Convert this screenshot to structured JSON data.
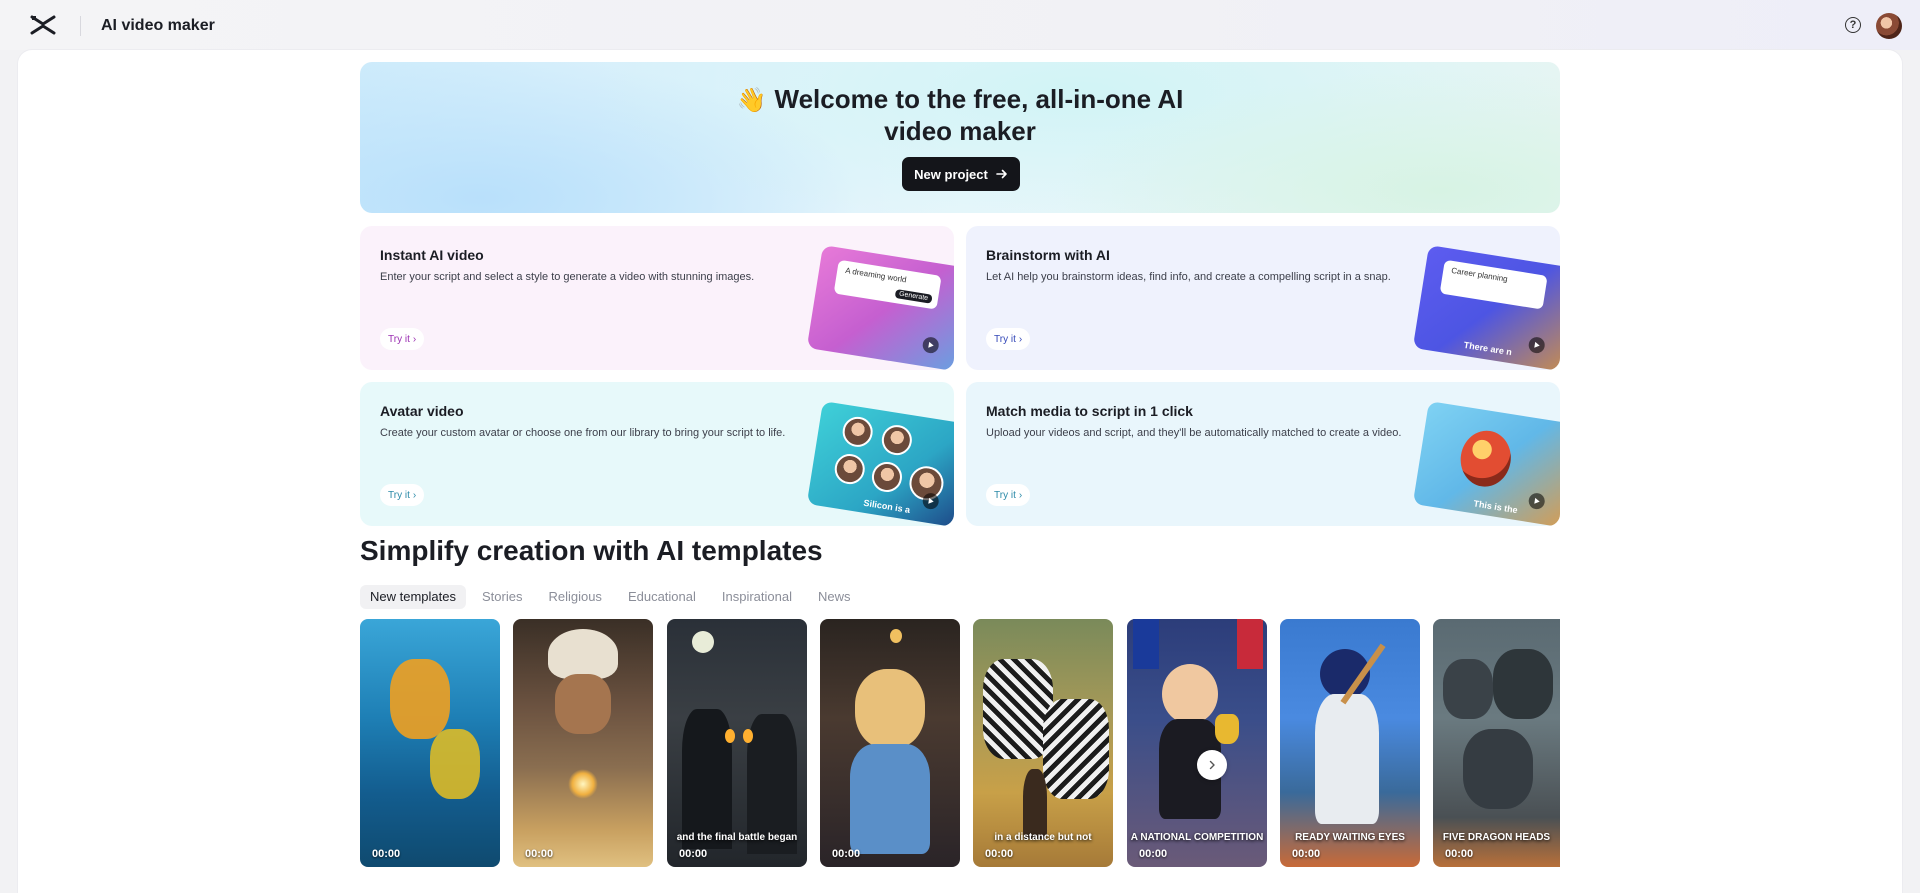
{
  "header": {
    "app_title": "AI video maker",
    "help_label": "?"
  },
  "hero": {
    "emoji": "👋",
    "title": "Welcome to the free, all-in-one AI video maker",
    "cta_label": "New project"
  },
  "cards": [
    {
      "title": "Instant AI video",
      "description": "Enter your script and select a style to generate a video with stunning images.",
      "try_label": "Try it",
      "art_text": "A dreaming world",
      "art_button": "Generate"
    },
    {
      "title": "Brainstorm with AI",
      "description": "Let AI help you brainstorm ideas, find info, and create a compelling script in a snap.",
      "try_label": "Try it",
      "art_text": "Career planning",
      "art_caption": "There are n"
    },
    {
      "title": "Avatar video",
      "description": "Create your custom avatar or choose one from our library to bring your script to life.",
      "try_label": "Try it",
      "art_caption": "Silicon is a"
    },
    {
      "title": "Match media to script in 1 click",
      "description": "Upload your videos and script, and they'll be automatically matched to create a video.",
      "try_label": "Try it",
      "art_caption": "This is the"
    }
  ],
  "templates_section": {
    "title": "Simplify creation with AI templates",
    "tabs": [
      "New templates",
      "Stories",
      "Religious",
      "Educational",
      "Inspirational",
      "News"
    ],
    "active_tab": "New templates",
    "items": [
      {
        "duration": "00:00",
        "caption": ""
      },
      {
        "duration": "00:00",
        "caption": ""
      },
      {
        "duration": "00:00",
        "caption": "and the final battle began"
      },
      {
        "duration": "00:00",
        "caption": ""
      },
      {
        "duration": "00:00",
        "caption": "in a distance but not"
      },
      {
        "duration": "00:00",
        "caption": "A NATIONAL COMPETITION"
      },
      {
        "duration": "00:00",
        "caption": "READY WAITING EYES"
      },
      {
        "duration": "00:00",
        "caption": "FIVE DRAGON HEADS"
      }
    ]
  },
  "colors": {
    "primary_button": "#14151a",
    "accent_pink": "#9b2fb2",
    "accent_blue": "#3448b8",
    "accent_teal": "#2b8aa8"
  }
}
